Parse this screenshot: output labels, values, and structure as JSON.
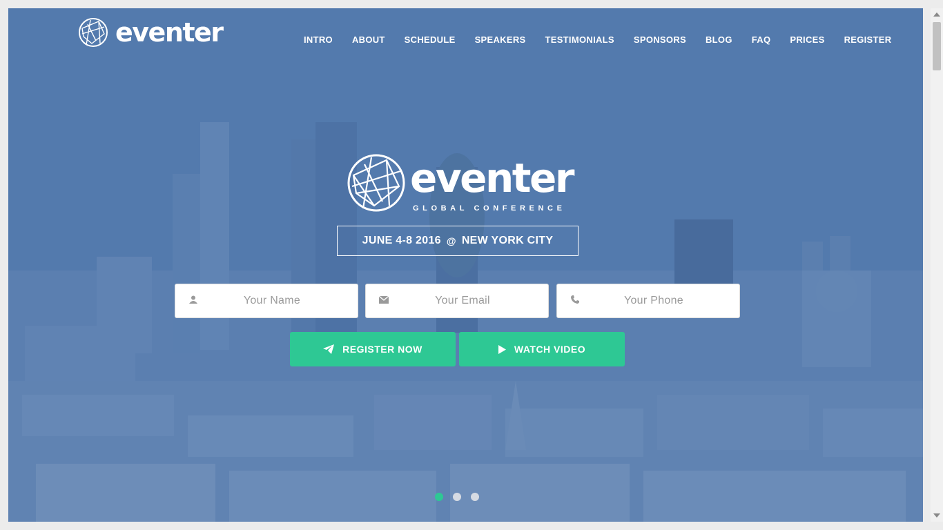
{
  "brand": {
    "name": "eventer",
    "logo_icon": "globe-mesh-icon"
  },
  "nav": {
    "items": [
      {
        "label": "INTRO"
      },
      {
        "label": "ABOUT"
      },
      {
        "label": "SCHEDULE"
      },
      {
        "label": "SPEAKERS"
      },
      {
        "label": "TESTIMONIALS"
      },
      {
        "label": "SPONSORS"
      },
      {
        "label": "BLOG"
      },
      {
        "label": "FAQ"
      },
      {
        "label": "PRICES"
      },
      {
        "label": "REGISTER"
      }
    ]
  },
  "hero": {
    "title": "eventer",
    "subtitle": "GLOBAL CONFERENCE",
    "date_text": "JUNE 4-8 2016",
    "location_text": "NEW YORK CITY",
    "at_icon": "at-sign-icon"
  },
  "form": {
    "name_placeholder": "Your Name",
    "email_placeholder": "Your Email",
    "phone_placeholder": "Your Phone",
    "name_icon": "user-icon",
    "email_icon": "envelope-icon",
    "phone_icon": "phone-icon"
  },
  "actions": {
    "register_label": "REGISTER NOW",
    "register_icon": "paper-plane-icon",
    "video_label": "WATCH VIDEO",
    "video_icon": "play-icon"
  },
  "slider": {
    "dot_count": 3,
    "active_index": 0
  },
  "colors": {
    "accent": "#2ec894",
    "overlay": "#3e68a0"
  }
}
